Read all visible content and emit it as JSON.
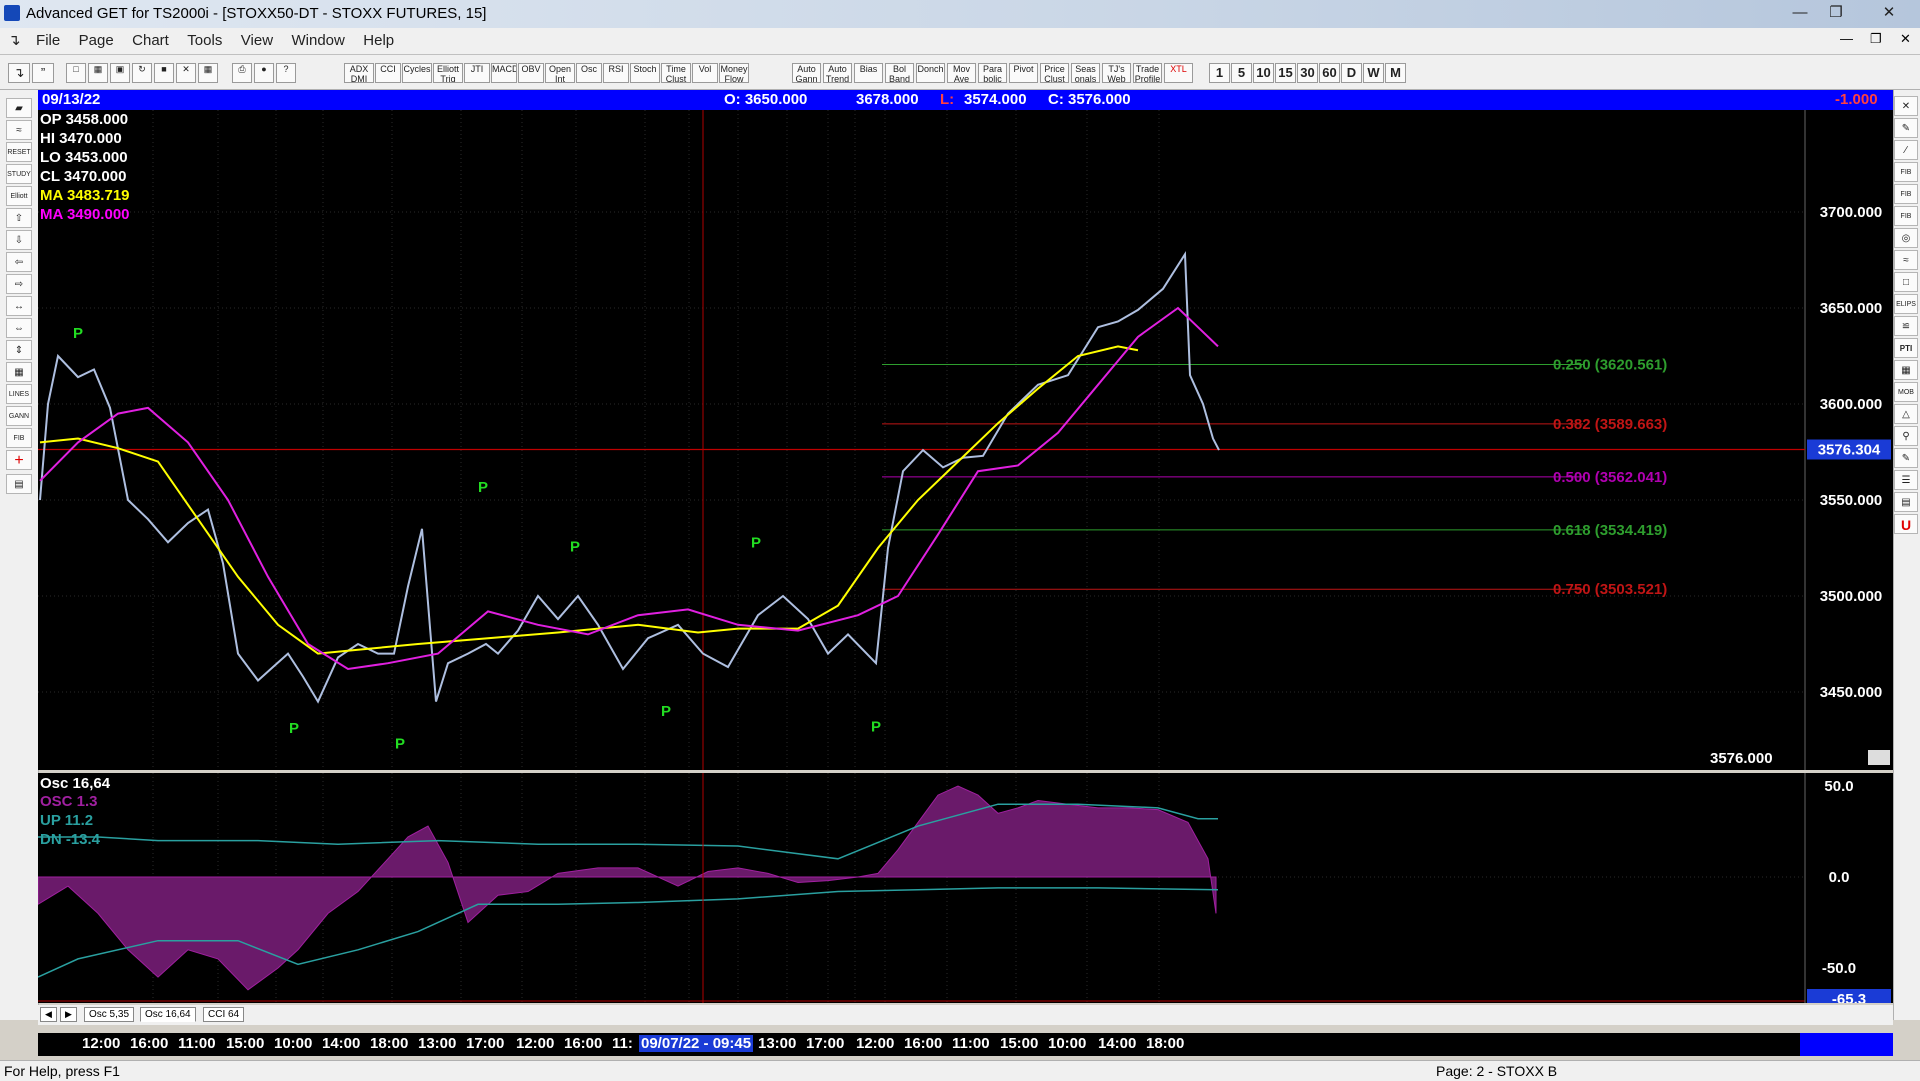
{
  "window": {
    "title": "Advanced GET for TS2000i - [STOXX50-DT - STOXX FUTURES, 15]"
  },
  "menu": [
    "File",
    "Page",
    "Chart",
    "Tools",
    "View",
    "Window",
    "Help"
  ],
  "toolbar": {
    "studies": [
      "ADX DMI",
      "CCI",
      "Cycles",
      "Elliott Trig",
      "JTI",
      "MACD",
      "OBV",
      "Open Int",
      "Osc",
      "RSI",
      "Stoch",
      "Time Clust",
      "Vol",
      "Money Flow"
    ],
    "tools": [
      "Auto Gann",
      "Auto Trend",
      "Bias",
      "Bol Band",
      "Donch",
      "Mov Ave",
      "Para bolic",
      "Pivot",
      "Price Clust",
      "Seas onals",
      "TJ's Web",
      "Trade Profile",
      "XTL"
    ],
    "intervals": [
      "1",
      "5",
      "10",
      "15",
      "30",
      "60",
      "D",
      "W",
      "M"
    ]
  },
  "header": {
    "date": "09/13/22",
    "open": "O: 3650.000",
    "high": "3678.000",
    "low_label": "L:",
    "low": "3574.000",
    "close": "C: 3576.000",
    "change": "-1.000"
  },
  "stats": [
    {
      "label": "OP 3458.000",
      "color": "#ffffff"
    },
    {
      "label": "HI  3470.000",
      "color": "#ffffff"
    },
    {
      "label": "LO  3453.000",
      "color": "#ffffff"
    },
    {
      "label": "CL  3470.000",
      "color": "#ffffff"
    },
    {
      "label": "MA  3483.719",
      "color": "#ffff00"
    },
    {
      "label": "MA  3490.000",
      "color": "#ff00ff"
    }
  ],
  "price_axis": {
    "ticks": [
      "3700.000",
      "3650.000",
      "3600.000",
      "3550.000",
      "3500.000",
      "3450.000"
    ],
    "current": "3576.304",
    "last": "3576.000"
  },
  "fib_levels": [
    {
      "label": "0.250 (3620.561)",
      "price": 3620.561,
      "color": "#2e9e2e"
    },
    {
      "label": "0.382 (3589.663)",
      "price": 3589.663,
      "color": "#c01515"
    },
    {
      "label": "0.500 (3562.041)",
      "price": 3562.041,
      "color": "#b000b0"
    },
    {
      "label": "0.618 (3534.419)",
      "price": 3534.419,
      "color": "#2e9e2e"
    },
    {
      "label": "0.750 (3503.521)",
      "price": 3503.521,
      "color": "#c01515"
    }
  ],
  "pivots": [
    "P",
    "P",
    "P",
    "P",
    "P",
    "P",
    "P",
    "P"
  ],
  "osc": {
    "title": "Osc 16,64",
    "stats": [
      {
        "label": "OSC 1.3",
        "color": "#a020a0"
      },
      {
        "label": "UP   11.2",
        "color": "#2aa0a0"
      },
      {
        "label": "DN   -13.4",
        "color": "#2aa0a0"
      }
    ],
    "ticks": [
      "50.0",
      "0.0",
      "-50.0"
    ],
    "current": "-65.3"
  },
  "tabs": [
    "Osc 5,35",
    "Osc 16,64",
    "CCI 64"
  ],
  "time_axis": {
    "labels": [
      "12:00",
      "16:00",
      "11:00",
      "15:00",
      "10:00",
      "14:00",
      "18:00",
      "13:00",
      "17:00",
      "12:00",
      "16:00",
      "11:",
      "4:00",
      "18:00",
      "13:00",
      "17:00",
      "12:00",
      "16:00",
      "11:00",
      "15:00",
      "10:00",
      "14:00",
      "18:00"
    ],
    "cursor": "09/07/22 - 09:45"
  },
  "status": {
    "help": "For Help, press F1",
    "page": "Page: 2 - STOXX B"
  }
}
